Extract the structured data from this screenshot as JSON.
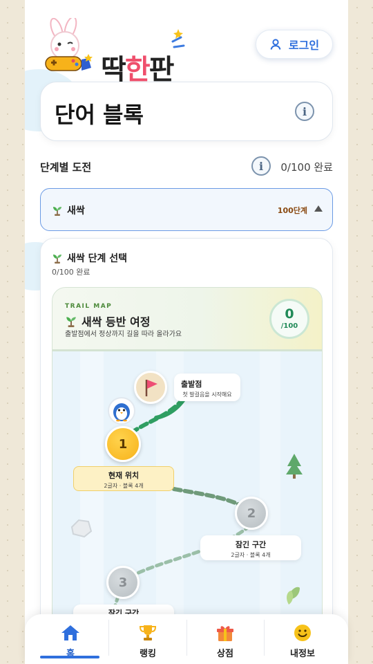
{
  "header": {
    "logo_text_parts": [
      "딱",
      "한",
      "판"
    ],
    "login_label": "로그인"
  },
  "title_card": {
    "title": "단어 블록",
    "info_glyph": "i"
  },
  "stage": {
    "label": "단계별 도전",
    "info_glyph": "i",
    "progress": "0/100 완료"
  },
  "dropdown": {
    "selected": "새싹",
    "count": "100단계"
  },
  "panel": {
    "title": "새싹 단계 선택",
    "progress": "0/100 완료"
  },
  "trail": {
    "tag": "TRAIL MAP",
    "title": "새싹 등반 여정",
    "description": "출발점에서 정상까지 길을 따라 올라가요",
    "score_num": "0",
    "score_den": "/100",
    "start": {
      "title": "출발점",
      "sub": "첫 발걸음을 시작해요"
    },
    "current": {
      "num": "1",
      "title": "현재 위치",
      "sub": "2글자 · 블록 4개"
    },
    "locked1": {
      "num": "2",
      "title": "잠긴 구간",
      "sub": "2글자 · 블록 4개"
    },
    "locked2": {
      "num": "3",
      "title": "잠긴 구간"
    }
  },
  "nav": {
    "items": [
      {
        "label": "홈",
        "icon": "home-icon"
      },
      {
        "label": "랭킹",
        "icon": "trophy-icon"
      },
      {
        "label": "상점",
        "icon": "gift-icon"
      },
      {
        "label": "내정보",
        "icon": "smile-icon"
      }
    ]
  },
  "colors": {
    "accent": "#2f6fdd",
    "trail_green": "#2f9e62",
    "gold": "#f7b21a",
    "page_bg": "#efe8d8"
  }
}
